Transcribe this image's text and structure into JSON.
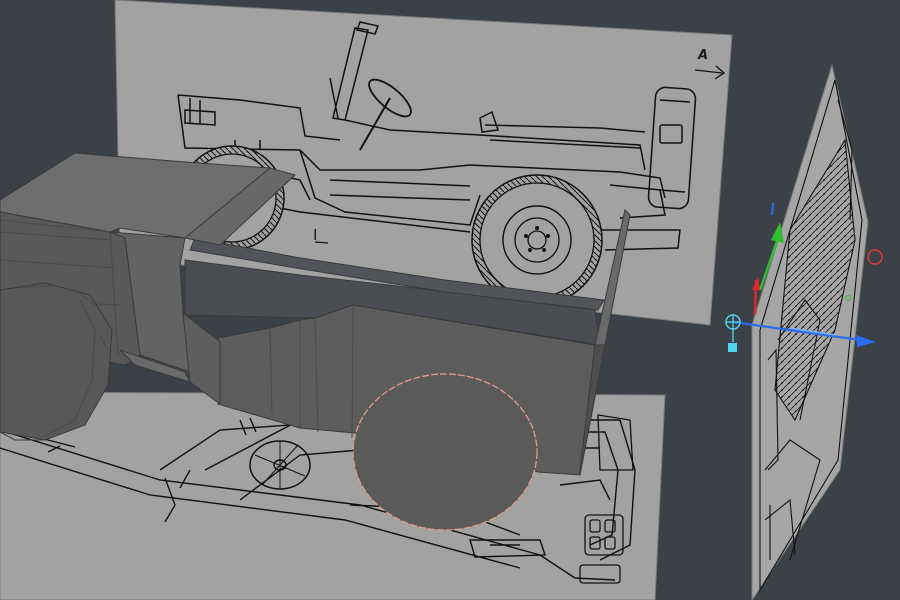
{
  "app": {
    "title": "",
    "viewport_background": "#3c4047"
  },
  "reference_images": {
    "side_view": {
      "view": "side",
      "annotation": "A",
      "marker": "I",
      "background": "#a2a2a2",
      "line_color": "#111111"
    },
    "top_view": {
      "view": "top",
      "background": "#a2a2a2",
      "line_color": "#111111"
    },
    "front_view": {
      "view": "front",
      "background": "#a2a2a2",
      "line_color": "#111111"
    }
  },
  "model": {
    "object": "jeep-body-mesh",
    "base_color": "#5a5a5a",
    "light_color": "#6e6e6e",
    "edge_color": "#3a3a3a",
    "wheel_color": "#595959",
    "selection_outline_color": "#e49a8e"
  },
  "gizmo": {
    "axes": [
      {
        "axis": "x",
        "color": "#2a6cf0"
      },
      {
        "axis": "y",
        "color": "#2ec02e"
      },
      {
        "axis": "z",
        "color": "#e02a2a"
      }
    ],
    "pivot_color": "#4fd6ea",
    "rotate_handle_color": "#e03a3a"
  }
}
